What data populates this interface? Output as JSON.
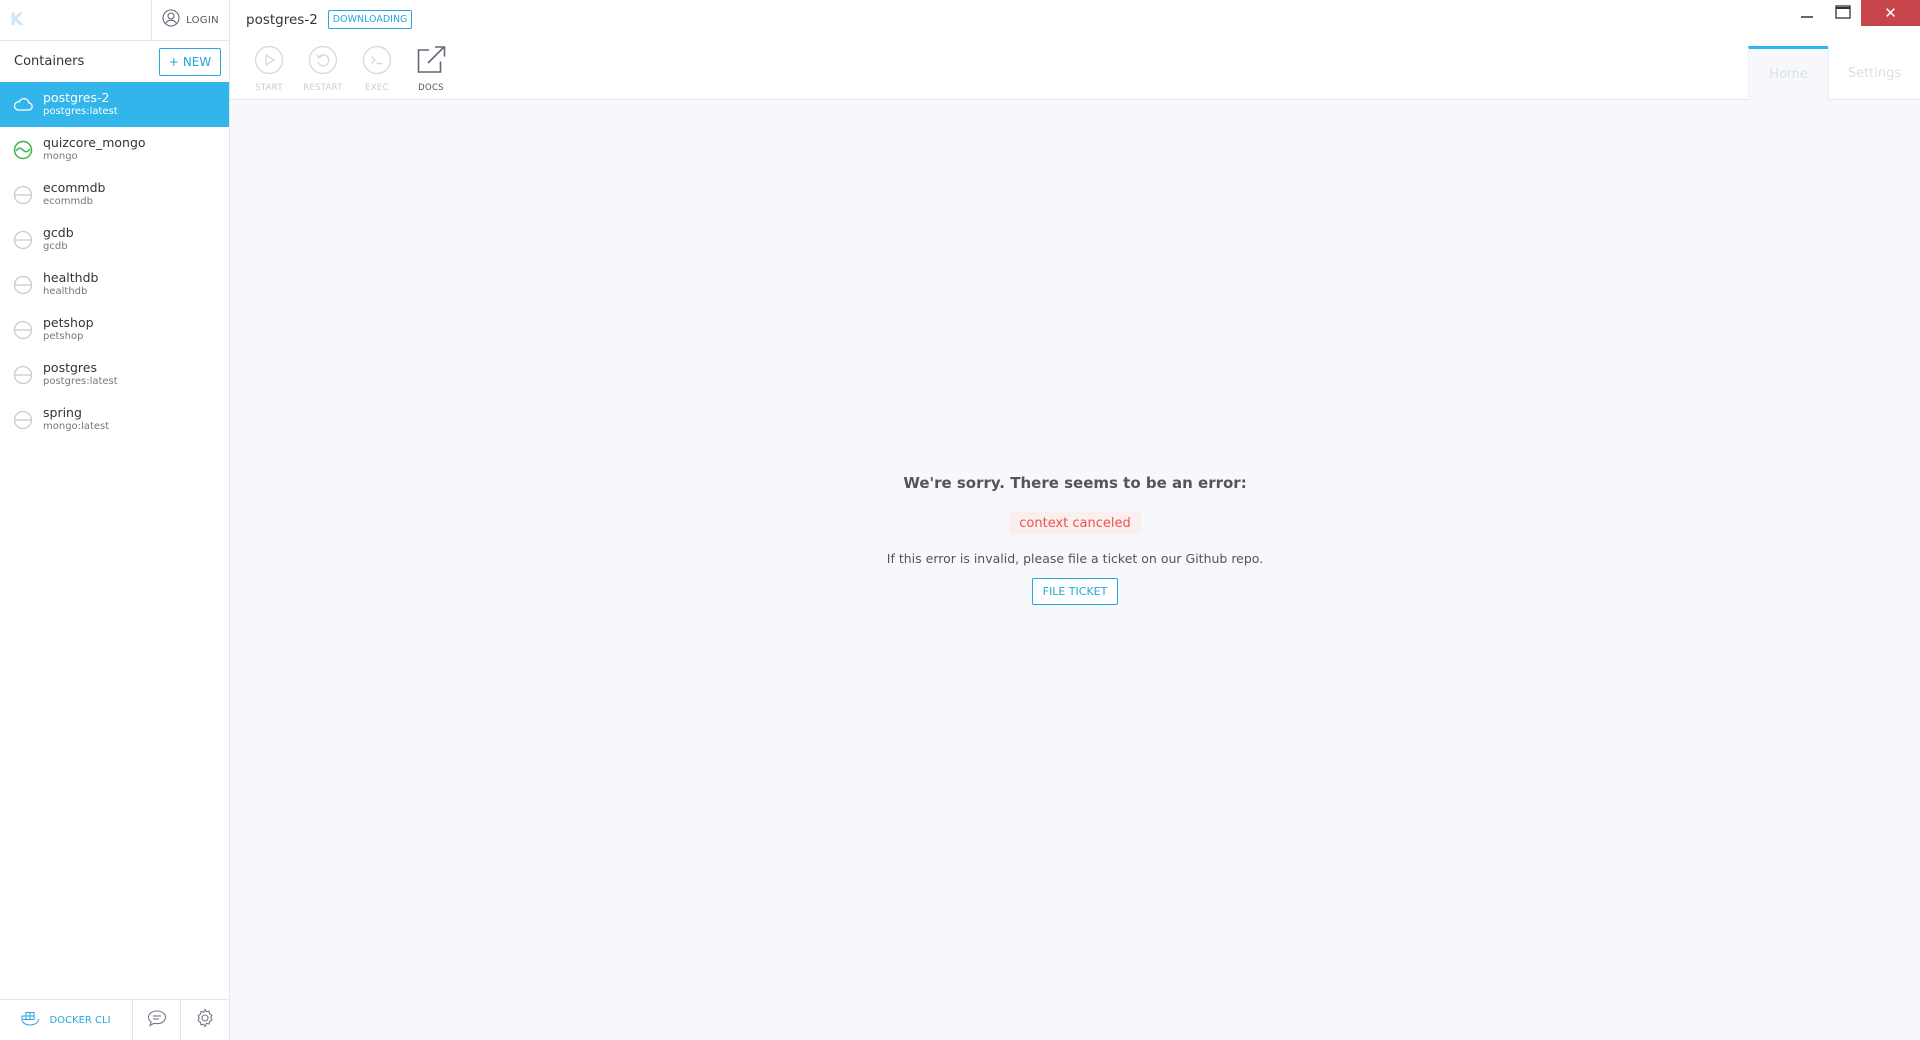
{
  "sidebar": {
    "logo": "K",
    "login_label": "LOGIN",
    "containers_title": "Containers",
    "new_button": "NEW",
    "items": [
      {
        "name": "postgres-2",
        "image": "postgres:latest",
        "state": "downloading"
      },
      {
        "name": "quizcore_mongo",
        "image": "mongo",
        "state": "running"
      },
      {
        "name": "ecommdb",
        "image": "ecommdb",
        "state": "stopped"
      },
      {
        "name": "gcdb",
        "image": "gcdb",
        "state": "stopped"
      },
      {
        "name": "healthdb",
        "image": "healthdb",
        "state": "stopped"
      },
      {
        "name": "petshop",
        "image": "petshop",
        "state": "stopped"
      },
      {
        "name": "postgres",
        "image": "postgres:latest",
        "state": "stopped"
      },
      {
        "name": "spring",
        "image": "mongo:latest",
        "state": "stopped"
      }
    ],
    "bottom": {
      "docker_cli": "DOCKER CLI"
    }
  },
  "header": {
    "container_title": "postgres-2",
    "status_badge": "DOWNLOADING",
    "toolbar": {
      "start": "START",
      "restart": "RESTART",
      "exec": "EXEC",
      "docs": "DOCS"
    },
    "tabs": [
      "Home",
      "Settings"
    ],
    "close_glyph": "✕"
  },
  "error": {
    "title": "We're sorry. There seems to be an error:",
    "message": "context canceled",
    "help": "If this error is invalid, please file a ticket on our Github repo.",
    "button": "FILE TICKET"
  },
  "colors": {
    "accent": "#26a6dd",
    "active_item": "#31b5ea",
    "running": "#3fb54a",
    "error_text": "#e8554e",
    "close_button": "#c7444a"
  }
}
